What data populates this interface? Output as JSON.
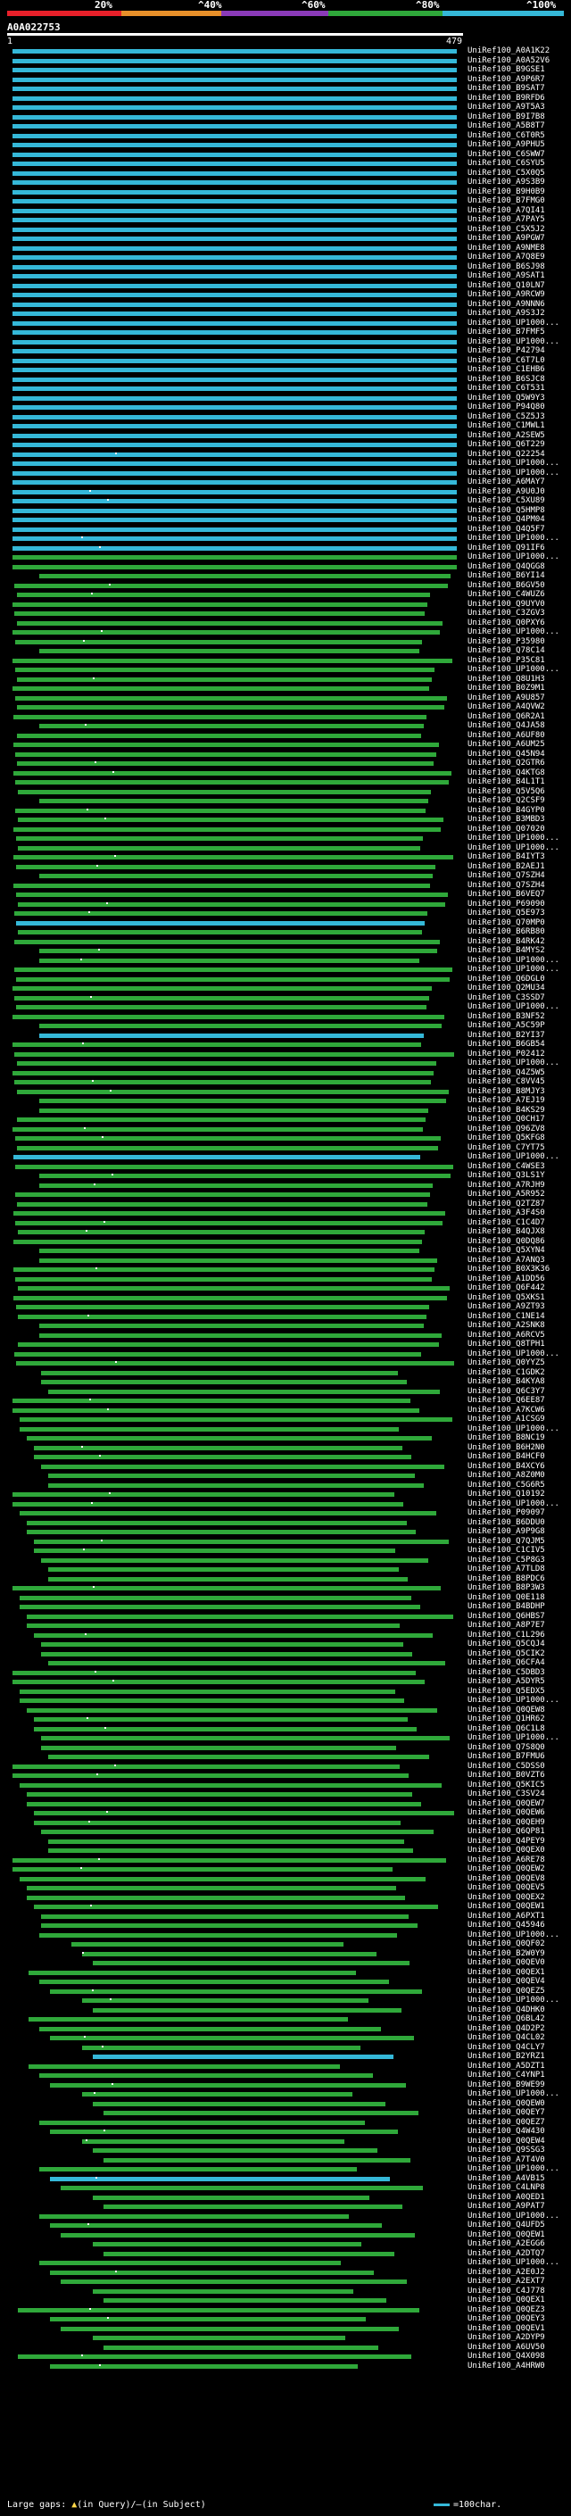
{
  "scale": {
    "labels": [
      "20%",
      "^40%",
      "^60%",
      "^80%",
      "^100%"
    ],
    "colors": [
      "#e8202a",
      "#e8902a",
      "#8a3ab8",
      "#2fa83a",
      "#35b8d8"
    ]
  },
  "query": {
    "id": "A0A022753",
    "start": "1",
    "end": "479"
  },
  "hits": [
    {
      "label": "UniRef100_A0A1K22",
      "color": "cyan"
    },
    {
      "label": "UniRef100_A0A52V6",
      "color": "cyan"
    },
    {
      "label": "UniRef100_B9GSE1",
      "color": "cyan"
    },
    {
      "label": "UniRef100_A9P6R7",
      "color": "cyan"
    },
    {
      "label": "UniRef100_B9SAT7",
      "color": "cyan"
    },
    {
      "label": "UniRef100_B9RFD6",
      "color": "cyan"
    },
    {
      "label": "UniRef100_A9T5A3",
      "color": "cyan"
    },
    {
      "label": "UniRef100_B9I7B8",
      "color": "cyan"
    },
    {
      "label": "UniRef100_A5B8T7",
      "color": "cyan"
    },
    {
      "label": "UniRef100_C6T0R5",
      "color": "cyan"
    },
    {
      "label": "UniRef100_A9PHU5",
      "color": "cyan"
    },
    {
      "label": "UniRef100_C6SWW7",
      "color": "cyan"
    },
    {
      "label": "UniRef100_C6SYU5",
      "color": "cyan"
    },
    {
      "label": "UniRef100_C5X0Q5",
      "color": "cyan"
    },
    {
      "label": "UniRef100_A9S3B9",
      "color": "cyan"
    },
    {
      "label": "UniRef100_B9H0B9",
      "color": "cyan"
    },
    {
      "label": "UniRef100_B7FMG0",
      "color": "cyan"
    },
    {
      "label": "UniRef100_A7QI41",
      "color": "cyan"
    },
    {
      "label": "UniRef100_A7PAY5",
      "color": "cyan"
    },
    {
      "label": "UniRef100_C5X5J2",
      "color": "cyan"
    },
    {
      "label": "UniRef100_A9PGW7",
      "color": "cyan"
    },
    {
      "label": "UniRef100_A9NME8",
      "color": "cyan"
    },
    {
      "label": "UniRef100_A7Q8E9",
      "color": "cyan"
    },
    {
      "label": "UniRef100_B6SJ98",
      "color": "cyan"
    },
    {
      "label": "UniRef100_A9SAT1",
      "color": "cyan"
    },
    {
      "label": "UniRef100_Q10LN7",
      "color": "cyan"
    },
    {
      "label": "UniRef100_A9RCW9",
      "color": "cyan"
    },
    {
      "label": "UniRef100_A9NNN6",
      "color": "cyan"
    },
    {
      "label": "UniRef100_A9S3J2",
      "color": "cyan"
    },
    {
      "label": "UniRef100_UP1000...",
      "color": "cyan"
    },
    {
      "label": "UniRef100_B7FMF5",
      "color": "cyan"
    },
    {
      "label": "UniRef100_UP1000...",
      "color": "cyan"
    },
    {
      "label": "UniRef100_P42794",
      "color": "cyan"
    },
    {
      "label": "UniRef100_C6T7L0",
      "color": "cyan"
    },
    {
      "label": "UniRef100_C1EHB6",
      "color": "cyan"
    },
    {
      "label": "UniRef100_B6SJC8",
      "color": "cyan"
    },
    {
      "label": "UniRef100_C6T531",
      "color": "cyan"
    },
    {
      "label": "UniRef100_Q5W9Y3",
      "color": "cyan"
    },
    {
      "label": "UniRef100_P94Q80",
      "color": "cyan"
    },
    {
      "label": "UniRef100_C5Z5J3",
      "color": "cyan"
    },
    {
      "label": "UniRef100_C1MWL1",
      "color": "cyan"
    },
    {
      "label": "UniRef100_A2SEW5",
      "color": "cyan"
    },
    {
      "label": "UniRef100_Q6T229",
      "color": "cyan"
    },
    {
      "label": "UniRef100_Q22254",
      "color": "cyan"
    },
    {
      "label": "UniRef100_UP1000...",
      "color": "cyan"
    },
    {
      "label": "UniRef100_UP1000...",
      "color": "cyan"
    },
    {
      "label": "UniRef100_A6MAY7",
      "color": "cyan"
    },
    {
      "label": "UniRef100_A9U0J0",
      "color": "cyan"
    },
    {
      "label": "UniRef100_C5XU89",
      "color": "cyan"
    },
    {
      "label": "UniRef100_Q5HMP8",
      "color": "cyan"
    },
    {
      "label": "UniRef100_Q4PM04",
      "color": "cyan"
    },
    {
      "label": "UniRef100_Q4Q5F7",
      "color": "cyan"
    },
    {
      "label": "UniRef100_UP1000...",
      "color": "cyan"
    },
    {
      "label": "UniRef100_Q91IF6",
      "color": "cyan"
    },
    {
      "label": "UniRef100_UP1000...",
      "color": "green"
    },
    {
      "label": "UniRef100_Q4QGG8",
      "color": "green"
    },
    {
      "label": "UniRef100_B6YI14",
      "color": "green"
    },
    {
      "label": "UniRef100_B6GV50",
      "color": "green"
    },
    {
      "label": "UniRef100_C4WUZ6",
      "color": "green"
    },
    {
      "label": "UniRef100_Q9UYV0",
      "color": "green"
    },
    {
      "label": "UniRef100_C3ZGV3",
      "color": "green"
    },
    {
      "label": "UniRef100_Q0PXY6",
      "color": "green"
    },
    {
      "label": "UniRef100_UP1000...",
      "color": "green"
    },
    {
      "label": "UniRef100_P35980",
      "color": "green"
    },
    {
      "label": "UniRef100_Q78C14",
      "color": "green"
    },
    {
      "label": "UniRef100_P35C81",
      "color": "green"
    },
    {
      "label": "UniRef100_UP1000...",
      "color": "green"
    },
    {
      "label": "UniRef100_Q8U1H3",
      "color": "green"
    },
    {
      "label": "UniRef100_B0Z9M1",
      "color": "green"
    },
    {
      "label": "UniRef100_A9U857",
      "color": "green"
    },
    {
      "label": "UniRef100_A4QVW2",
      "color": "green"
    },
    {
      "label": "UniRef100_Q6R2A1",
      "color": "green"
    },
    {
      "label": "UniRef100_Q4JA58",
      "color": "green"
    },
    {
      "label": "UniRef100_A6UF80",
      "color": "green"
    },
    {
      "label": "UniRef100_A6UM25",
      "color": "green"
    },
    {
      "label": "UniRef100_Q45N94",
      "color": "green"
    },
    {
      "label": "UniRef100_Q2GTR6",
      "color": "green"
    },
    {
      "label": "UniRef100_Q4KTG8",
      "color": "green"
    },
    {
      "label": "UniRef100_B4L1T1",
      "color": "green"
    },
    {
      "label": "UniRef100_Q5V5Q6",
      "color": "green"
    },
    {
      "label": "UniRef100_Q2CSF9",
      "color": "green"
    },
    {
      "label": "UniRef100_B4GYP0",
      "color": "green"
    },
    {
      "label": "UniRef100_B3MBD3",
      "color": "green"
    },
    {
      "label": "UniRef100_Q07020",
      "color": "green"
    },
    {
      "label": "UniRef100_UP1000...",
      "color": "green"
    },
    {
      "label": "UniRef100_UP1000...",
      "color": "green"
    },
    {
      "label": "UniRef100_B4IYT3",
      "color": "green"
    },
    {
      "label": "UniRef100_B2AEJ1",
      "color": "green"
    },
    {
      "label": "UniRef100_Q7SZH4",
      "color": "green"
    },
    {
      "label": "UniRef100_Q7SZH4",
      "color": "green"
    },
    {
      "label": "UniRef100_B6VEQ7",
      "color": "green"
    },
    {
      "label": "UniRef100_P69090",
      "color": "green"
    },
    {
      "label": "UniRef100_Q5E973",
      "color": "green"
    },
    {
      "label": "UniRef100_Q70MP0",
      "color": "cyan"
    },
    {
      "label": "UniRef100_B6RB80",
      "color": "green"
    },
    {
      "label": "UniRef100_B4RK42",
      "color": "green"
    },
    {
      "label": "UniRef100_B4MYS2",
      "color": "green"
    },
    {
      "label": "UniRef100_UP1000...",
      "color": "green"
    },
    {
      "label": "UniRef100_UP1000...",
      "color": "green"
    },
    {
      "label": "UniRef100_Q6DGL0",
      "color": "green"
    },
    {
      "label": "UniRef100_Q2MU34",
      "color": "green"
    },
    {
      "label": "UniRef100_C3SSD7",
      "color": "green"
    },
    {
      "label": "UniRef100_UP1000...",
      "color": "green"
    },
    {
      "label": "UniRef100_B3NF52",
      "color": "green"
    },
    {
      "label": "UniRef100_A5C59P",
      "color": "green"
    },
    {
      "label": "UniRef100_B2YI37",
      "color": "cyan"
    },
    {
      "label": "UniRef100_B6GB54",
      "color": "green"
    },
    {
      "label": "UniRef100_P02412",
      "color": "green"
    },
    {
      "label": "UniRef100_UP1000...",
      "color": "green"
    },
    {
      "label": "UniRef100_Q4Z5W5",
      "color": "green"
    },
    {
      "label": "UniRef100_C8VV45",
      "color": "green"
    },
    {
      "label": "UniRef100_B8MJY3",
      "color": "green"
    },
    {
      "label": "UniRef100_A7EJ19",
      "color": "green"
    },
    {
      "label": "UniRef100_B4KS29",
      "color": "green"
    },
    {
      "label": "UniRef100_Q0CH17",
      "color": "green"
    },
    {
      "label": "UniRef100_Q96ZV8",
      "color": "green"
    },
    {
      "label": "UniRef100_Q5KFG8",
      "color": "green"
    },
    {
      "label": "UniRef100_C7YT75",
      "color": "green"
    },
    {
      "label": "UniRef100_UP1000...",
      "color": "cyan"
    },
    {
      "label": "UniRef100_C4WSE3",
      "color": "green"
    },
    {
      "label": "UniRef100_Q3LS1Y",
      "color": "green"
    },
    {
      "label": "UniRef100_A7RJH9",
      "color": "green"
    },
    {
      "label": "UniRef100_A5R952",
      "color": "green"
    },
    {
      "label": "UniRef100_Q2TZ87",
      "color": "green"
    },
    {
      "label": "UniRef100_A3F4S0",
      "color": "green"
    },
    {
      "label": "UniRef100_C1C4D7",
      "color": "green"
    },
    {
      "label": "UniRef100_B4QJX8",
      "color": "green"
    },
    {
      "label": "UniRef100_Q0DQ86",
      "color": "green"
    },
    {
      "label": "UniRef100_Q5XYN4",
      "color": "green"
    },
    {
      "label": "UniRef100_A7ANQ3",
      "color": "green"
    },
    {
      "label": "UniRef100_B0X3K36",
      "color": "green"
    },
    {
      "label": "UniRef100_A1DD56",
      "color": "green"
    },
    {
      "label": "UniRef100_Q6F442",
      "color": "green"
    },
    {
      "label": "UniRef100_Q5XKS1",
      "color": "green"
    },
    {
      "label": "UniRef100_A9ZT93",
      "color": "green"
    },
    {
      "label": "UniRef100_C1NE14",
      "color": "green"
    },
    {
      "label": "UniRef100_A2SNK8",
      "color": "green"
    },
    {
      "label": "UniRef100_A6RCV5",
      "color": "green"
    },
    {
      "label": "UniRef100_Q8TPH1",
      "color": "green"
    },
    {
      "label": "UniRef100_UP1000...",
      "color": "green"
    },
    {
      "label": "UniRef100_Q0YYZ5",
      "color": "green"
    },
    {
      "label": "UniRef100_C1GDK2",
      "color": "green"
    },
    {
      "label": "UniRef100_B4KYA8",
      "color": "green"
    },
    {
      "label": "UniRef100_Q6C3Y7",
      "color": "green"
    },
    {
      "label": "UniRef100_Q6EE87",
      "color": "green"
    },
    {
      "label": "UniRef100_A7KCW6",
      "color": "green"
    },
    {
      "label": "UniRef100_A1CSG9",
      "color": "green"
    },
    {
      "label": "UniRef100_UP1000...",
      "color": "green"
    },
    {
      "label": "UniRef100_B8NC19",
      "color": "green"
    },
    {
      "label": "UniRef100_B6H2N0",
      "color": "green"
    },
    {
      "label": "UniRef100_B4HCF0",
      "color": "green"
    },
    {
      "label": "UniRef100_B4XCY6",
      "color": "green"
    },
    {
      "label": "UniRef100_A8Z0M0",
      "color": "green"
    },
    {
      "label": "UniRef100_C5G6R5",
      "color": "green"
    },
    {
      "label": "UniRef100_Q10192",
      "color": "green"
    },
    {
      "label": "UniRef100_UP1000...",
      "color": "green"
    },
    {
      "label": "UniRef100_P09097",
      "color": "green"
    },
    {
      "label": "UniRef100_B6DDU0",
      "color": "green"
    },
    {
      "label": "UniRef100_A9P9G8",
      "color": "green"
    },
    {
      "label": "UniRef100_Q7QJM5",
      "color": "green"
    },
    {
      "label": "UniRef100_C1CIV5",
      "color": "green"
    },
    {
      "label": "UniRef100_C5P8G3",
      "color": "green"
    },
    {
      "label": "UniRef100_A7TLD8",
      "color": "green"
    },
    {
      "label": "UniRef100_B8PDC6",
      "color": "green"
    },
    {
      "label": "UniRef100_B8P3W3",
      "color": "green"
    },
    {
      "label": "UniRef100_Q0E118",
      "color": "green"
    },
    {
      "label": "UniRef100_B4BDHP",
      "color": "green"
    },
    {
      "label": "UniRef100_Q6HBS7",
      "color": "green"
    },
    {
      "label": "UniRef100_A8P7E7",
      "color": "green"
    },
    {
      "label": "UniRef100_C1L296",
      "color": "green"
    },
    {
      "label": "UniRef100_Q5CQJ4",
      "color": "green"
    },
    {
      "label": "UniRef100_Q5CIK2",
      "color": "green"
    },
    {
      "label": "UniRef100_Q6CFA4",
      "color": "green"
    },
    {
      "label": "UniRef100_C5DBD3",
      "color": "green"
    },
    {
      "label": "UniRef100_A5DYR5",
      "color": "green"
    },
    {
      "label": "UniRef100_Q5EDX5",
      "color": "green"
    },
    {
      "label": "UniRef100_UP1000...",
      "color": "green"
    },
    {
      "label": "UniRef100_Q0QEW8",
      "color": "green"
    },
    {
      "label": "UniRef100_Q1HR62",
      "color": "green"
    },
    {
      "label": "UniRef100_Q6C1L8",
      "color": "green"
    },
    {
      "label": "UniRef100_UP1000...",
      "color": "green"
    },
    {
      "label": "UniRef100_Q7S8Q0",
      "color": "green"
    },
    {
      "label": "UniRef100_B7FMU6",
      "color": "green"
    },
    {
      "label": "UniRef100_C5DSS0",
      "color": "green"
    },
    {
      "label": "UniRef100_B0VZT6",
      "color": "green"
    },
    {
      "label": "UniRef100_Q5KIC5",
      "color": "green"
    },
    {
      "label": "UniRef100_C3SV24",
      "color": "green"
    },
    {
      "label": "UniRef100_Q0QEW7",
      "color": "green"
    },
    {
      "label": "UniRef100_Q0QEW6",
      "color": "green"
    },
    {
      "label": "UniRef100_Q0QEH9",
      "color": "green"
    },
    {
      "label": "UniRef100_Q6QP81",
      "color": "green"
    },
    {
      "label": "UniRef100_Q4PEY9",
      "color": "green"
    },
    {
      "label": "UniRef100_Q0QEX0",
      "color": "green"
    },
    {
      "label": "UniRef100_A6RE78",
      "color": "green"
    },
    {
      "label": "UniRef100_Q0QEW2",
      "color": "green"
    },
    {
      "label": "UniRef100_Q0QEV8",
      "color": "green"
    },
    {
      "label": "UniRef100_Q0QEV5",
      "color": "green"
    },
    {
      "label": "UniRef100_Q0QEX2",
      "color": "green"
    },
    {
      "label": "UniRef100_Q0QEW1",
      "color": "green"
    },
    {
      "label": "UniRef100_A6PXT1",
      "color": "green"
    },
    {
      "label": "UniRef100_Q45946",
      "color": "green"
    },
    {
      "label": "UniRef100_UP1000...",
      "color": "green"
    },
    {
      "label": "UniRef100_Q0QF02",
      "color": "green"
    },
    {
      "label": "UniRef100_B2W0Y9",
      "color": "green"
    },
    {
      "label": "UniRef100_Q0QEV0",
      "color": "green"
    },
    {
      "label": "UniRef100_Q0QEX1",
      "color": "green"
    },
    {
      "label": "UniRef100_Q0QEV4",
      "color": "green"
    },
    {
      "label": "UniRef100_Q0QEZ5",
      "color": "green"
    },
    {
      "label": "UniRef100_UP1000...",
      "color": "green"
    },
    {
      "label": "UniRef100_Q4DHK0",
      "color": "green"
    },
    {
      "label": "UniRef100_Q6BL42",
      "color": "green"
    },
    {
      "label": "UniRef100_Q4D2P2",
      "color": "green"
    },
    {
      "label": "UniRef100_Q4CL02",
      "color": "green"
    },
    {
      "label": "UniRef100_Q4CLY7",
      "color": "green"
    },
    {
      "label": "UniRef100_B2YRZ1",
      "color": "cyan"
    },
    {
      "label": "UniRef100_A5DZT1",
      "color": "green"
    },
    {
      "label": "UniRef100_C4YNP1",
      "color": "green"
    },
    {
      "label": "UniRef100_B9WE99",
      "color": "green"
    },
    {
      "label": "UniRef100_UP1000...",
      "color": "green"
    },
    {
      "label": "UniRef100_Q0QEW0",
      "color": "green"
    },
    {
      "label": "UniRef100_Q0QEY7",
      "color": "green"
    },
    {
      "label": "UniRef100_Q0QEZ7",
      "color": "green"
    },
    {
      "label": "UniRef100_Q4W430",
      "color": "green"
    },
    {
      "label": "UniRef100_Q0QEW4",
      "color": "green"
    },
    {
      "label": "UniRef100_Q9SSG3",
      "color": "green"
    },
    {
      "label": "UniRef100_A7T4V0",
      "color": "green"
    },
    {
      "label": "UniRef100_UP1000...",
      "color": "green"
    },
    {
      "label": "UniRef100_A4VB15",
      "color": "cyan"
    },
    {
      "label": "UniRef100_C4LNP8",
      "color": "green"
    },
    {
      "label": "UniRef100_A0QED1",
      "color": "green"
    },
    {
      "label": "UniRef100_A9PAT7",
      "color": "green"
    },
    {
      "label": "UniRef100_UP1000...",
      "color": "green"
    },
    {
      "label": "UniRef100_Q4UFD5",
      "color": "green"
    },
    {
      "label": "UniRef100_Q0QEW1",
      "color": "green"
    },
    {
      "label": "UniRef100_A2EGG6",
      "color": "green"
    },
    {
      "label": "UniRef100_A2DTQ7",
      "color": "green"
    },
    {
      "label": "UniRef100_UP1000...",
      "color": "green"
    },
    {
      "label": "UniRef100_A2E0J2",
      "color": "green"
    },
    {
      "label": "UniRef100_A2EXT7",
      "color": "green"
    },
    {
      "label": "UniRef100_C4J778",
      "color": "green"
    },
    {
      "label": "UniRef100_Q0QEX1",
      "color": "green"
    },
    {
      "label": "UniRef100_Q0QEZ3",
      "color": "green"
    },
    {
      "label": "UniRef100_Q0QEY3",
      "color": "green"
    },
    {
      "label": "UniRef100_Q0QEV1",
      "color": "green"
    },
    {
      "label": "UniRef100_A2DYP9",
      "color": "green"
    },
    {
      "label": "UniRef100_A6UV50",
      "color": "green"
    },
    {
      "label": "UniRef100_Q4X098",
      "color": "green"
    },
    {
      "label": "UniRef100_A4HRW0",
      "color": "green"
    }
  ],
  "legend": {
    "large_gaps": "Large gaps:",
    "in_query": "(in Query)/",
    "in_subject": "(in Subject)",
    "scale": "=100char."
  }
}
